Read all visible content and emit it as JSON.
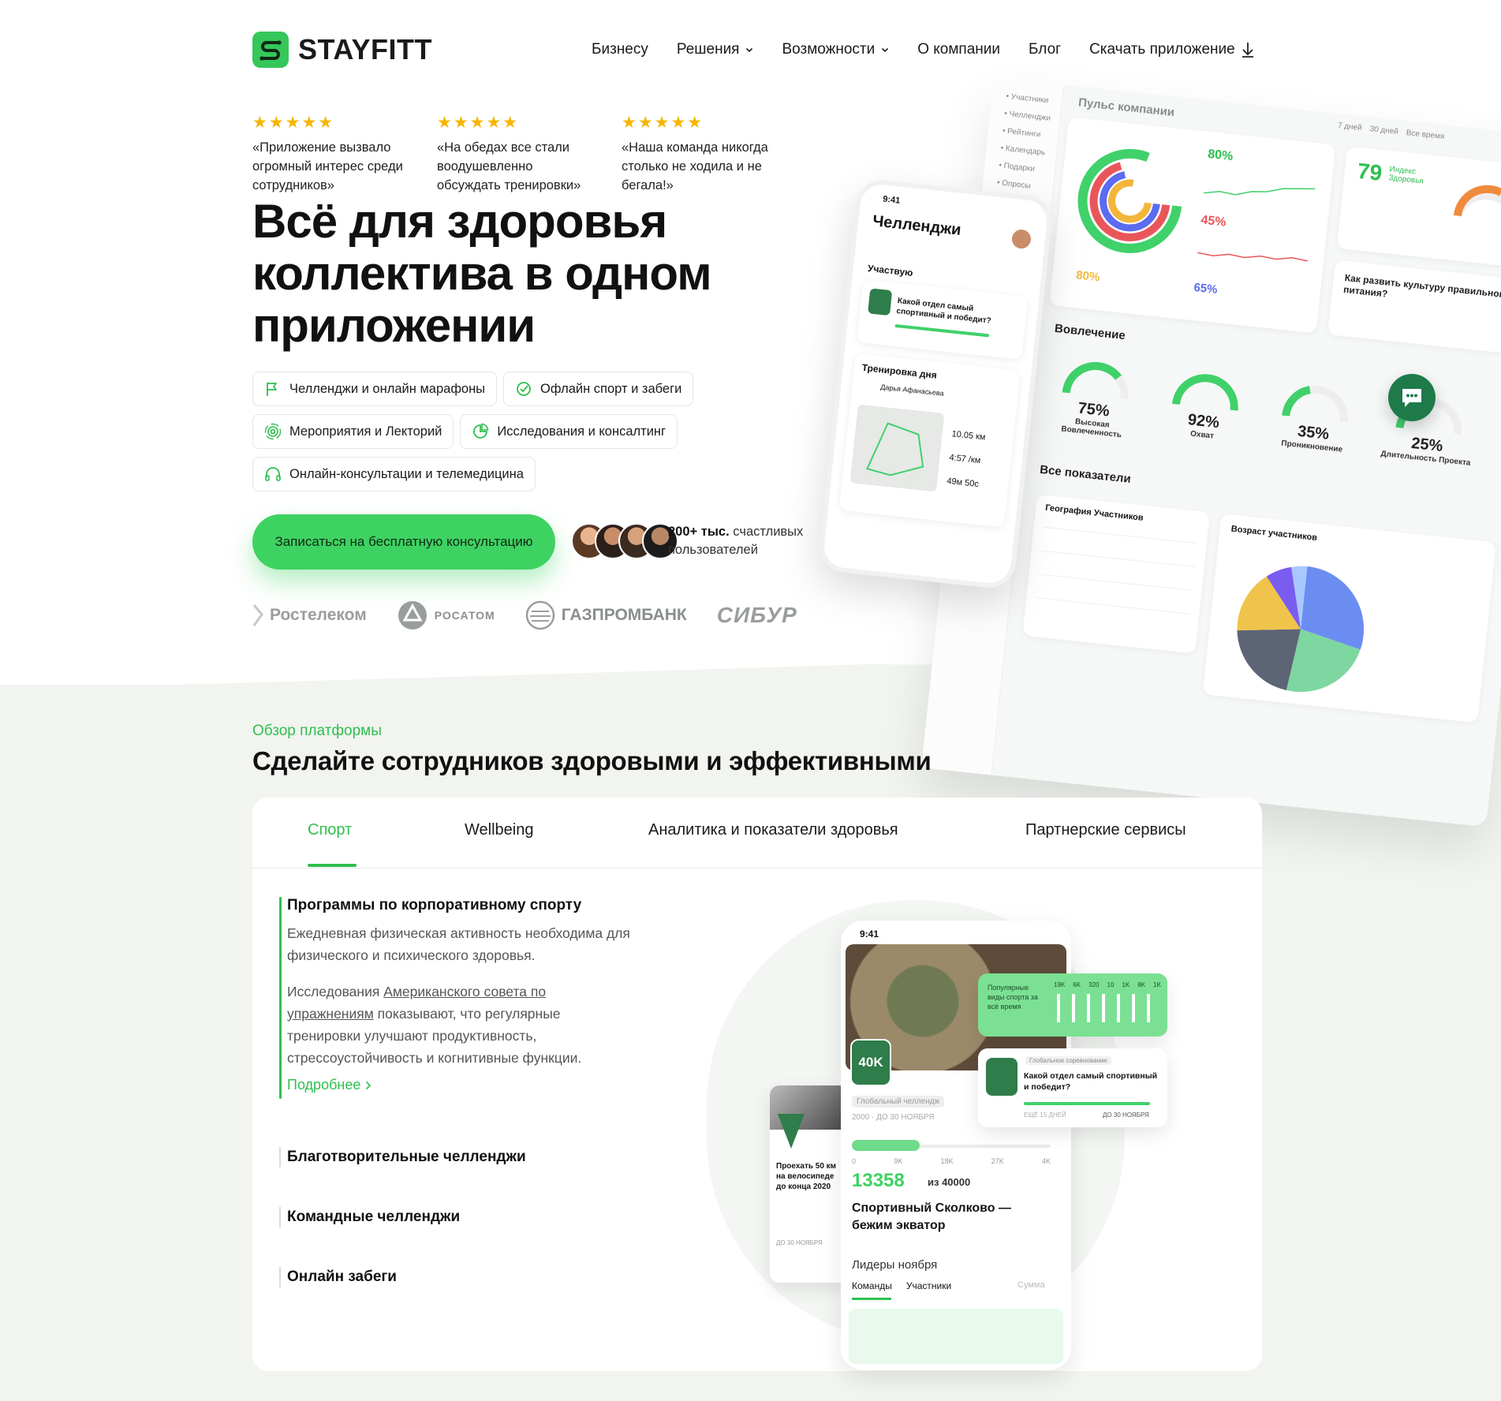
{
  "brand": {
    "name": "STAYFITT",
    "accent": "#2fbf4f"
  },
  "nav": {
    "items": [
      {
        "label": "Бизнесу",
        "dropdown": false
      },
      {
        "label": "Решения",
        "dropdown": true
      },
      {
        "label": "Возможности",
        "dropdown": true
      },
      {
        "label": "О компании",
        "dropdown": false
      },
      {
        "label": "Блог",
        "dropdown": false
      },
      {
        "label": "Скачать приложение",
        "dropdown": false,
        "icon": "download-icon"
      }
    ]
  },
  "reviews": [
    {
      "stars": "★★★★★",
      "text": "«Приложение вызвало огромный интерес среди сотрудников»"
    },
    {
      "stars": "★★★★★",
      "text": "«На обедах все стали воодушевленно обсуждать тренировки»"
    },
    {
      "stars": "★★★★★",
      "text": "«Наша команда никогда столько не ходила и не бегала!»"
    }
  ],
  "hero": {
    "title": "Всё для здоровья коллектива в одном приложении",
    "features": [
      {
        "label": "Челленджи и онлайн марафоны",
        "icon": "flag-icon"
      },
      {
        "label": "Офлайн спорт и забеги",
        "icon": "badge-check-icon"
      },
      {
        "label": "Мероприятия и Лекторий",
        "icon": "broadcast-icon"
      },
      {
        "label": "Исследования и консалтинг",
        "icon": "pie-chart-icon"
      },
      {
        "label": "Онлайн-консультации и телемедицина",
        "icon": "headphones-icon"
      }
    ],
    "cta": "Записаться на бесплатную консультацию",
    "users_count": "200+ тыс.",
    "users_text_1": "счастливых",
    "users_text_2": "пользователей"
  },
  "partners": [
    "Ростелеком",
    "РОСАТОМ",
    "ГАЗПРОМБАНК",
    "СИБУР"
  ],
  "dashboard": {
    "title": "Пульс компании",
    "ranges": [
      "7 дней",
      "30 дней",
      "Все время"
    ],
    "index_value": "79",
    "index_label": "Индекс Здоровья",
    "stat_80": "80%",
    "stat_45": "45%",
    "stat_65": "65%",
    "involvement_title": "Вовлечение",
    "kpis": [
      {
        "value": "75%",
        "label": "Высокая Вовлеченность"
      },
      {
        "value": "92%",
        "label": "Охват"
      },
      {
        "value": "35%",
        "label": "Проникновение"
      },
      {
        "value": "25%",
        "label": "Длительность Проекта"
      }
    ],
    "all_title": "Все показатели",
    "geo_title": "География Участников",
    "age_title": "Возраст участников",
    "article_title": "Как развить культуру правильного питания?"
  },
  "phone": {
    "time": "9:41",
    "title": "Челленджи",
    "participating": "Участвую",
    "challenge": "Какой отдел самый спортивный и победит?",
    "workout_title": "Тренировка дня",
    "workout_user": "Дарья Афанасьева",
    "distance": "10.05 км",
    "pace": "4:57 /км",
    "time_val": "49м 50с"
  },
  "section": {
    "eyebrow": "Обзор платформы",
    "title": "Сделайте сотрудников здоровыми и эффективными"
  },
  "tabs": [
    {
      "label": "Спорт",
      "active": true
    },
    {
      "label": "Wellbeing",
      "active": false
    },
    {
      "label": "Аналитика и показатели здоровья",
      "active": false
    },
    {
      "label": "Партнерские сервисы",
      "active": false
    }
  ],
  "accordion": {
    "active": {
      "title": "Программы по корпоративному спорту",
      "p1": "Ежедневная физическая активность необходима для физического и психического здоровья.",
      "p2_before": "Исследования ",
      "p2_link": "Американского совета по упражнениям",
      "p2_after": " показывают, что регулярные тренировки улучшают продуктивность, стрессоустойчивость и когнитивные функции.",
      "more": "Подробнее"
    },
    "items": [
      "Благотворительные челленджи",
      "Командные челленджи",
      "Онлайн забеги"
    ]
  },
  "illustration": {
    "time": "9:41",
    "badge": "40K",
    "global_label": "Глобальный челлендж",
    "deadline": "2000 · ДО 30 НОЯБРЯ",
    "scale": [
      "0",
      "9K",
      "18K",
      "27K",
      "4K"
    ],
    "progress": 0.34,
    "value": "13358",
    "value_of": "из 40000",
    "event": "Спортивный Сколково — бежим экватор",
    "leaders": "Лидеры ноября",
    "leaders_tabs": [
      "Команды",
      "Участники"
    ],
    "sum": "Сумма",
    "popular": "Популярные виды спорта за всё время",
    "popular_values": [
      "19K",
      "6K",
      "320",
      "10",
      "1K",
      "8K",
      "1K"
    ],
    "competition": "Глобальное соревнование",
    "competition_q": "Какой отдел самый спортивный и победит?",
    "competition_left": "ЕЩЁ 15 ДНЕЙ",
    "competition_deadline": "ДО 30 НОЯБРЯ",
    "side_card": "Проехать 50 км на велосипеде до конца 2020",
    "side_deadline": "ДО 30 НОЯБРЯ"
  }
}
